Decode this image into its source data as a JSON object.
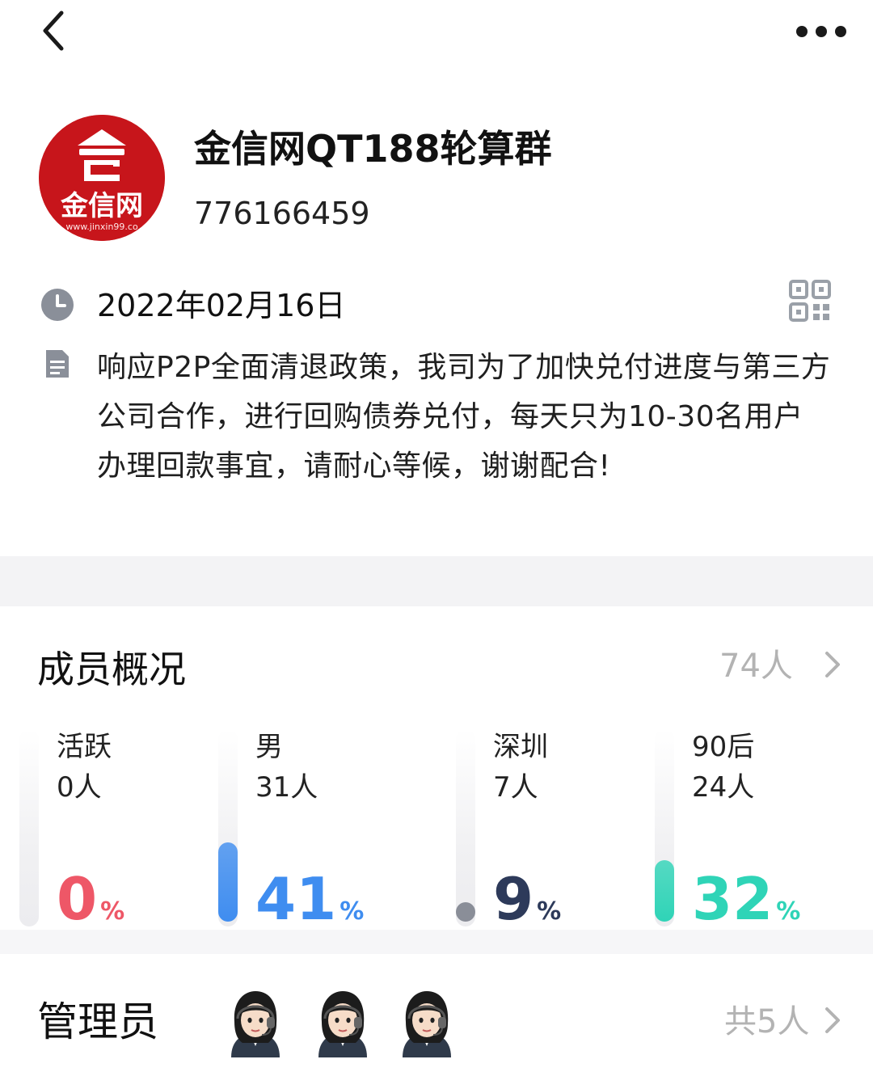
{
  "header": {
    "group_name": "金信网QT188轮算群",
    "group_id": "776166459",
    "avatar": {
      "brand_text": "金信网",
      "url_text": "www.jinxin99.co"
    }
  },
  "info": {
    "date": "2022年02月16日",
    "description": "响应P2P全面清退政策，我司为了加快兑付进度与第三方公司合作，进行回购债券兑付，每天只为10-30名用户办理回款事宜，请耐心等候，谢谢配合!"
  },
  "members": {
    "title": "成员概况",
    "count": "74人",
    "stats": [
      {
        "label": "活跃",
        "count": "0人",
        "percent": "0",
        "unit": "%",
        "value": 0,
        "color": "#ee5767"
      },
      {
        "label": "男",
        "count": "31人",
        "percent": "41",
        "unit": "%",
        "value": 0.41,
        "color": "#3f8df0"
      },
      {
        "label": "深圳",
        "count": "7人",
        "percent": "9",
        "unit": "%",
        "value": 0.09,
        "color": "#2d3a5a"
      },
      {
        "label": "90后",
        "count": "24人",
        "percent": "32",
        "unit": "%",
        "value": 0.32,
        "color": "#2fd4b7"
      }
    ]
  },
  "admins": {
    "title": "管理员",
    "count": "共5人"
  },
  "icons": [
    "back-icon",
    "more-icon",
    "clock-icon",
    "qr-code-icon",
    "document-icon",
    "chevron-right-icon"
  ]
}
